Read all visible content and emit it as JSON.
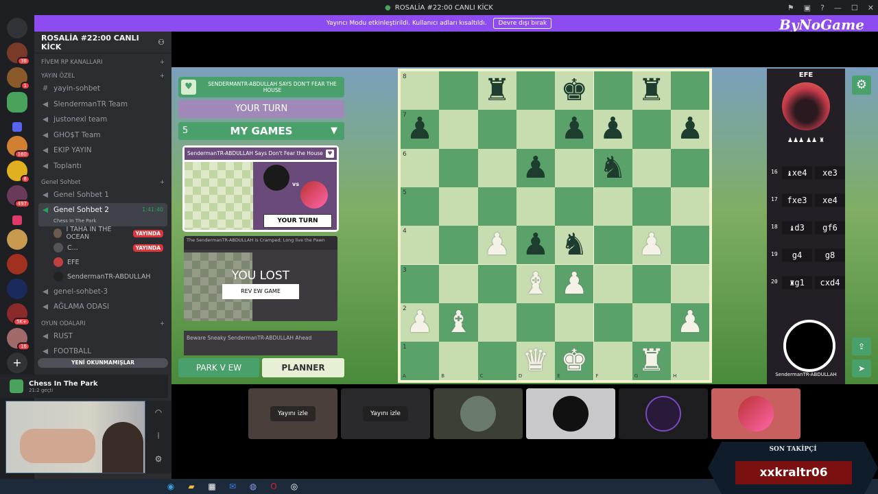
{
  "window": {
    "title": "ROSALİA #22:00 CANLI KİCK",
    "brand": "ByNoGame"
  },
  "banner": {
    "text": "Yayıncı Modu etkinleştirildi. Kullanıcı adları kısaltıldı.",
    "button": "Devre dışı bırak"
  },
  "servers": [
    {
      "badge": "38"
    },
    {
      "badge": "1"
    },
    {
      "badge": ""
    },
    {
      "badge": ""
    },
    {
      "badge": ""
    },
    {
      "badge": "160"
    },
    {
      "badge": "6"
    },
    {
      "badge": "497"
    },
    {
      "badge": ""
    },
    {
      "badge": ""
    },
    {
      "badge": ""
    },
    {
      "badge": ""
    },
    {
      "badge": "5K+"
    },
    {
      "badge": "16"
    }
  ],
  "sidebar": {
    "server_name": "ROSALİA #22:00 CANLI KİCK",
    "categories": {
      "fivem": "FİVEM RP KANALLARI",
      "yayin": "YAYIN ÖZEL",
      "genel": "Genel Sohbet",
      "oyun": "OYUN ODALARI"
    },
    "yayin_channels": [
      "yayin-sohbet",
      "SlendermanTR Team",
      "justonexl team",
      "GHO$T Team",
      "EKIP YAYIN",
      "Toplantı"
    ],
    "genel_channels": {
      "g1": "Genel Sohbet 1",
      "g2": "Genel Sohbet 2",
      "g2_timer": "1:41:40",
      "g2_sub": "Chess In The Park",
      "g3": "genel-sohbet-3",
      "aglama": "AĞLAMA ODASI"
    },
    "voice_users": [
      {
        "name": "I TAHA IN THE OCEAN",
        "live": "YAYINDA"
      },
      {
        "name": "C...",
        "live": "YAYINDA"
      },
      {
        "name": "EFE",
        "live": ""
      },
      {
        "name": "SendermanTR-ABDULLAH",
        "live": ""
      }
    ],
    "oyun_channels": [
      "RUST",
      "FOOTBALL"
    ],
    "new_unread": "YENİ OKUNMAMIŞLAR"
  },
  "activity": {
    "title": "Chess In The Park",
    "time": "21:2 geçti"
  },
  "game": {
    "top_banner": "SENDERMANTR-ABDULLAH SAYS DON'T FEAR THE HOUSE",
    "your_turn": "YOUR TURN",
    "my_games_count": "5",
    "my_games_label": "MY GAMES",
    "card1_title": "SendermanTR-ABDULLAH Says Don't Fear the House",
    "card1_vs": "vs",
    "card1_button": "YOUR TURN",
    "card2_title": "The SendermanTR-ABDULLAH is Cramped; Long live the Pawn",
    "card2_result": "YOU LOST",
    "card2_button": "REV EW GAME",
    "card3_title": "Beware Sneaky SendermanTR-ABDULLAH Ahead",
    "park_view": "PARK V EW",
    "planner": "PLANNER",
    "ranks": [
      "8",
      "7",
      "6",
      "5",
      "4",
      "3",
      "2",
      "1"
    ],
    "files": [
      "A",
      "B",
      "C",
      "D",
      "E",
      "F",
      "G",
      "H"
    ],
    "opponent_name": "EFE",
    "captured": "♟♟♟ ♟♟ ♜",
    "moves": [
      {
        "n": "16",
        "w": "♝xe4",
        "b": "xe3"
      },
      {
        "n": "17",
        "w": "fxe3",
        "b": "xe4"
      },
      {
        "n": "18",
        "w": "♝d3",
        "b": "gf6"
      },
      {
        "n": "19",
        "w": "g4",
        "b": "g8"
      },
      {
        "n": "20",
        "w": "♜g1",
        "b": "cxd4"
      }
    ],
    "player_name": "SendermanTR-ABDULLAH"
  },
  "tiles": [
    {
      "label": "Yayını izle"
    },
    {
      "label": "Yayını izle"
    }
  ],
  "overlay": {
    "title": "SON TAKİPÇİ",
    "name": "xxkraltr06"
  }
}
